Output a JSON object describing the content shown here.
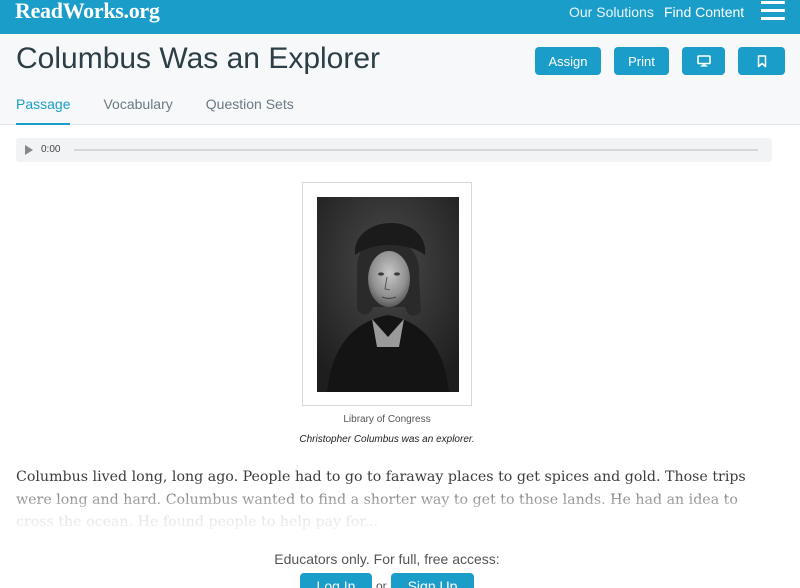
{
  "brand": {
    "logo_text": "ReadWorks.org",
    "accent_color": "#1a9ec9"
  },
  "topnav": {
    "solutions_label": "Our Solutions",
    "find_label": "Find Content",
    "menu_icon": "hamburger-menu-icon"
  },
  "header": {
    "title": "Columbus Was an Explorer",
    "buttons": {
      "assign_label": "Assign",
      "print_label": "Print",
      "present_icon": "monitor-icon",
      "save_icon": "bookmark-icon"
    },
    "tabs": [
      {
        "label": "Passage",
        "active": true
      },
      {
        "label": "Vocabulary",
        "active": false
      },
      {
        "label": "Question Sets",
        "active": false
      }
    ]
  },
  "audio": {
    "time": "0:00",
    "play_icon": "play-icon",
    "progress": 0
  },
  "figure": {
    "credit": "Library of Congress",
    "caption": "Christopher Columbus was an explorer."
  },
  "passage": {
    "text": "Columbus lived long, long ago. People had to go to faraway places to get spices and gold. Those trips were long and hard. Columbus wanted to find a shorter way to get to those lands. He had an idea to cross the ocean. He found people to help pay for..."
  },
  "access": {
    "message": "Educators only. For full, free access:",
    "login_label": "Log In",
    "or_text": "or",
    "signup_label": "Sign Up"
  }
}
